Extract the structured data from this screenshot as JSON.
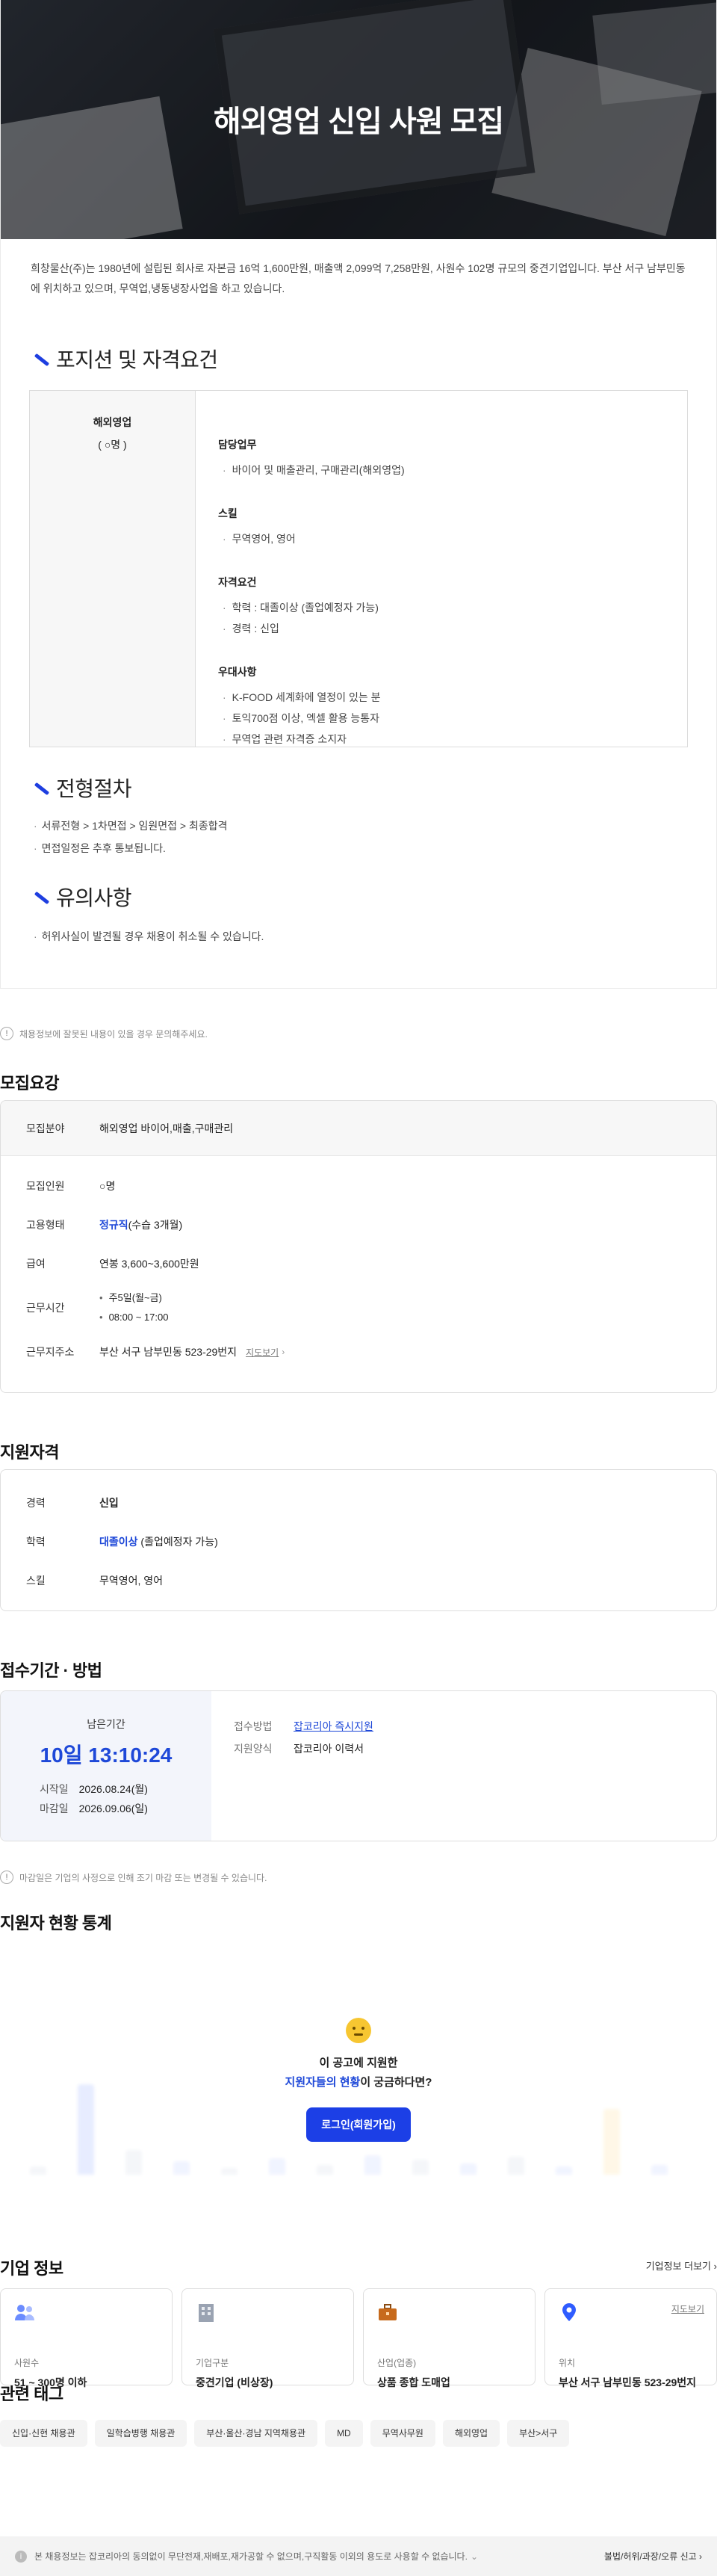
{
  "posting": {
    "title": "해외영업 신입 사원 모집",
    "intro": "희창물산(주)는 1980년에 설립된 회사로 자본금 16억 1,600만원, 매출액 2,099억 7,258만원, 사원수 102명 규모의 중견기업입니다. 부산 서구 남부민동에 위치하고 있으며, 무역업,냉동냉장사업을 하고 있습니다.",
    "position_section_title": "포지션 및 자격요건",
    "position": {
      "name": "해외영업",
      "count": "( ○명 )",
      "groups": [
        {
          "title": "담당업무",
          "items": [
            "바이어 및 매출관리, 구매관리(해외영업)"
          ]
        },
        {
          "title": "스킬",
          "items": [
            "무역영어, 영어"
          ]
        },
        {
          "title": "자격요건",
          "items": [
            "학력 : 대졸이상 (졸업예정자 가능)",
            "경력 : 신입"
          ]
        },
        {
          "title": "우대사항",
          "items": [
            "K-FOOD 세계화에 열정이 있는 분",
            "토익700점 이상, 엑셀 활용 능통자",
            "무역업 관련 자격증 소지자"
          ]
        }
      ]
    },
    "process_title": "전형절차",
    "process_items": [
      "서류전형 > 1차면접 > 임원면접 > 최종합격",
      "면접일정은 추후 통보됩니다."
    ],
    "caution_title": "유의사항",
    "caution_items": [
      "허위사실이 발견될 경우 채용이 취소될 수 있습니다."
    ],
    "report_text": "채용정보에 잘못된 내용이 있을 경우 문의해주세요."
  },
  "recruit": {
    "title": "모집요강",
    "field_label": "모집분야",
    "field_value": "해외영업 바이어,매출,구매관리",
    "headcount_label": "모집인원",
    "headcount_value": "○명",
    "type_label": "고용형태",
    "type_value_strong": "정규직",
    "type_value_rest": "(수습 3개월)",
    "salary_label": "급여",
    "salary_value": "연봉 3,600~3,600만원",
    "hours_label": "근무시간",
    "hours_values": [
      "주5일(월~금)",
      "08:00 ~ 17:00"
    ],
    "location_label": "근무지주소",
    "location_value": "부산 서구 남부민동 523-29번지",
    "map_link": "지도보기"
  },
  "qualification": {
    "title": "지원자격",
    "career_label": "경력",
    "career_value": "신입",
    "edu_label": "학력",
    "edu_value_strong": "대졸이상",
    "edu_value_rest": " (졸업예정자 가능)",
    "skill_label": "스킬",
    "skill_value": "무역영어, 영어"
  },
  "apply": {
    "title": "접수기간 · 방법",
    "remaining_label": "남은기간",
    "countdown": "10일 13:10:24",
    "start_label": "시작일",
    "start_value": "2026.08.24(월)",
    "end_label": "마감일",
    "end_value": "2026.09.06(일)",
    "method_label": "접수방법",
    "method_value": "잡코리아 즉시지원",
    "form_label": "지원양식",
    "form_value": "잡코리아 이력서",
    "note": "마감일은 기업의 사정으로 인해 조기 마감 또는 변경될 수 있습니다."
  },
  "stats": {
    "title": "지원자 현황 통계",
    "question_line1": "이 공고에 지원한",
    "question_strong": "지원자들의 현황",
    "question_rest": "이 궁금하다면?",
    "login_button": "로그인(회원가입)",
    "bar_levels": [
      0.05,
      0.55,
      0.15,
      0.08,
      0.04,
      0.1,
      0.06,
      0.12,
      0.09,
      0.07,
      0.11,
      0.05,
      0.4,
      0.06
    ],
    "bar_colors": [
      "#c9d6ff",
      "#a9bcff",
      "#d8dde8",
      "#ffe3a8"
    ]
  },
  "company": {
    "title": "기업 정보",
    "more": "기업정보 더보기",
    "cards": [
      {
        "icon": "people-icon",
        "label": "사원수",
        "value": "51 ~ 300명 이하"
      },
      {
        "icon": "building-icon",
        "label": "기업구분",
        "value": "중견기업 (비상장)"
      },
      {
        "icon": "briefcase-icon",
        "label": "산업(업종)",
        "value": "상품 종합 도매업"
      },
      {
        "icon": "pin-icon",
        "label": "위치",
        "value": "부산 서구 남부민동 523-29번지",
        "map": "지도보기"
      }
    ]
  },
  "tags": {
    "title": "관련 태그",
    "items": [
      "신입·신현 채용관",
      "일학습병행 채용관",
      "부산·울산·경남 지역채용관",
      "MD",
      "무역사무원",
      "해외영업",
      "부산>서구"
    ]
  },
  "notice": {
    "text": "본 채용정보는 잡코리아의 동의없이 무단전재,재배포,재가공할 수 없으며,구직활동 이외의 용도로 사용할 수 없습니다.",
    "report": "불법/허위/과장/오류 신고"
  },
  "colors": {
    "accent": "#1e48d8",
    "button": "#1c3fe6"
  }
}
